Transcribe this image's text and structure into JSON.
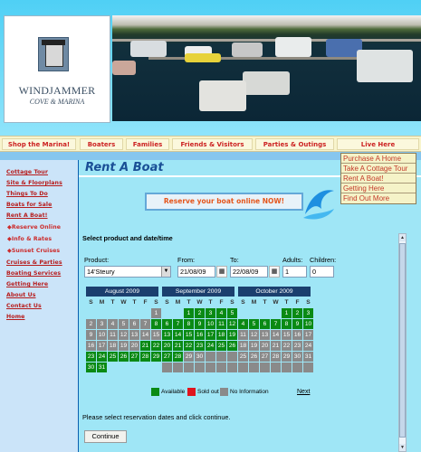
{
  "logo": {
    "name": "WINDJAMMER",
    "subtitle": "COVE & MARINA"
  },
  "nav": {
    "items": [
      "Shop the Marina!",
      "Boaters",
      "Families",
      "Friends & Visitors",
      "Parties & Outings",
      "Live Here"
    ]
  },
  "dropdown": {
    "items": [
      "Purchase A Home",
      "Take A Cottage Tour",
      "Rent A Boat!",
      "Getting Here",
      "Find Out More"
    ]
  },
  "sidebar": {
    "items": [
      "Cottage Tour",
      "Site & Floorplans",
      "Things To Do",
      "Boats for Sale",
      "Rent A Boat!",
      "◆Reserve Online",
      "◆Info & Rates",
      "◆Sunset Cruises",
      "Cruises & Parties",
      "Boating Services",
      "Getting Here",
      "About Us",
      "Contact Us",
      "Home"
    ]
  },
  "page": {
    "title": "Rent A Boat"
  },
  "banner": {
    "text": "Reserve your boat online NOW!"
  },
  "form": {
    "heading": "Select product and date/time",
    "product_label": "Product:",
    "product_value": "14'Steury",
    "from_label": "From:",
    "from_value": "21/08/09",
    "to_label": "To:",
    "to_value": "22/08/09",
    "adults_label": "Adults:",
    "adults_value": "1",
    "children_label": "Children:",
    "children_value": "0"
  },
  "calendars": [
    {
      "title": "August 2009",
      "weekdays": [
        "S",
        "M",
        "T",
        "W",
        "T",
        "F",
        "S"
      ],
      "days": [
        [
          "",
          "x"
        ],
        [
          "",
          "x"
        ],
        [
          "",
          "x"
        ],
        [
          "",
          "x"
        ],
        [
          "",
          "x"
        ],
        [
          "",
          "x"
        ],
        [
          "1",
          "na"
        ],
        [
          "2",
          "na"
        ],
        [
          "3",
          "na"
        ],
        [
          "4",
          "na"
        ],
        [
          "5",
          "na"
        ],
        [
          "6",
          "na"
        ],
        [
          "7",
          "na"
        ],
        [
          "8",
          "av"
        ],
        [
          "9",
          "na"
        ],
        [
          "10",
          "na"
        ],
        [
          "11",
          "na"
        ],
        [
          "12",
          "na"
        ],
        [
          "13",
          "na"
        ],
        [
          "14",
          "na"
        ],
        [
          "15",
          "na"
        ],
        [
          "16",
          "na"
        ],
        [
          "17",
          "na"
        ],
        [
          "18",
          "na"
        ],
        [
          "19",
          "na"
        ],
        [
          "20",
          "na"
        ],
        [
          "21",
          "av"
        ],
        [
          "22",
          "av"
        ],
        [
          "23",
          "av"
        ],
        [
          "24",
          "av"
        ],
        [
          "25",
          "av"
        ],
        [
          "26",
          "av"
        ],
        [
          "27",
          "av"
        ],
        [
          "28",
          "av"
        ],
        [
          "29",
          "av"
        ],
        [
          "30",
          "av"
        ],
        [
          "31",
          "av"
        ],
        [
          "",
          "x"
        ],
        [
          "",
          "x"
        ],
        [
          "",
          "x"
        ],
        [
          "",
          "x"
        ],
        [
          "",
          "x"
        ]
      ]
    },
    {
      "title": "September 2009",
      "weekdays": [
        "S",
        "M",
        "T",
        "W",
        "T",
        "F",
        "S"
      ],
      "days": [
        [
          "",
          "x"
        ],
        [
          "",
          "x"
        ],
        [
          "1",
          "av"
        ],
        [
          "2",
          "av"
        ],
        [
          "3",
          "av"
        ],
        [
          "4",
          "av"
        ],
        [
          "5",
          "av"
        ],
        [
          "6",
          "av"
        ],
        [
          "7",
          "av"
        ],
        [
          "8",
          "av"
        ],
        [
          "9",
          "av"
        ],
        [
          "10",
          "av"
        ],
        [
          "11",
          "av"
        ],
        [
          "12",
          "av"
        ],
        [
          "13",
          "av"
        ],
        [
          "14",
          "av"
        ],
        [
          "15",
          "av"
        ],
        [
          "16",
          "av"
        ],
        [
          "17",
          "av"
        ],
        [
          "18",
          "av"
        ],
        [
          "19",
          "av"
        ],
        [
          "20",
          "av"
        ],
        [
          "21",
          "av"
        ],
        [
          "22",
          "av"
        ],
        [
          "23",
          "av"
        ],
        [
          "24",
          "av"
        ],
        [
          "25",
          "av"
        ],
        [
          "26",
          "av"
        ],
        [
          "27",
          "av"
        ],
        [
          "28",
          "av"
        ],
        [
          "29",
          "na"
        ],
        [
          "30",
          "na"
        ],
        [
          "",
          "na"
        ],
        [
          "",
          "na"
        ],
        [
          "",
          "na"
        ],
        [
          "",
          "na"
        ],
        [
          "",
          "na"
        ],
        [
          "",
          "na"
        ],
        [
          "",
          "na"
        ],
        [
          "",
          "na"
        ],
        [
          "",
          "na"
        ],
        [
          "",
          "na"
        ]
      ]
    },
    {
      "title": "October 2009",
      "weekdays": [
        "S",
        "M",
        "T",
        "W",
        "T",
        "F",
        "S"
      ],
      "days": [
        [
          "",
          "x"
        ],
        [
          "",
          "x"
        ],
        [
          "",
          "x"
        ],
        [
          "",
          "x"
        ],
        [
          "1",
          "av"
        ],
        [
          "2",
          "av"
        ],
        [
          "3",
          "av"
        ],
        [
          "4",
          "av"
        ],
        [
          "5",
          "av"
        ],
        [
          "6",
          "av"
        ],
        [
          "7",
          "av"
        ],
        [
          "8",
          "av"
        ],
        [
          "9",
          "av"
        ],
        [
          "10",
          "av"
        ],
        [
          "11",
          "na"
        ],
        [
          "12",
          "na"
        ],
        [
          "13",
          "na"
        ],
        [
          "14",
          "na"
        ],
        [
          "15",
          "na"
        ],
        [
          "16",
          "na"
        ],
        [
          "17",
          "na"
        ],
        [
          "18",
          "na"
        ],
        [
          "19",
          "na"
        ],
        [
          "20",
          "na"
        ],
        [
          "21",
          "na"
        ],
        [
          "22",
          "na"
        ],
        [
          "23",
          "na"
        ],
        [
          "24",
          "na"
        ],
        [
          "25",
          "na"
        ],
        [
          "26",
          "na"
        ],
        [
          "27",
          "na"
        ],
        [
          "28",
          "na"
        ],
        [
          "29",
          "na"
        ],
        [
          "30",
          "na"
        ],
        [
          "31",
          "na"
        ],
        [
          "",
          "na"
        ],
        [
          "",
          "na"
        ],
        [
          "",
          "na"
        ],
        [
          "",
          "na"
        ],
        [
          "",
          "na"
        ],
        [
          "",
          "na"
        ],
        [
          "",
          "na"
        ]
      ]
    }
  ],
  "legend": {
    "available": "Available",
    "sold_out": "Sold out",
    "no_info": "No Information",
    "next": "Next"
  },
  "instruction": "Please select reservation dates and click continue.",
  "continue_label": "Continue",
  "colors": {
    "available": "#0a8a14",
    "sold_out": "#e0141e",
    "no_info": "#8a8a8a",
    "link_red": "#cc2222"
  }
}
